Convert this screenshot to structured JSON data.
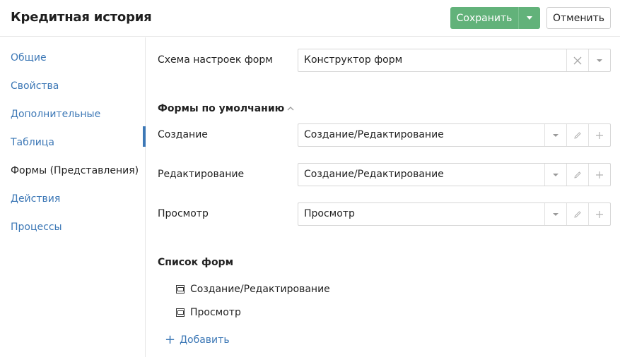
{
  "header": {
    "title": "Кредитная история",
    "save_label": "Сохранить",
    "cancel_label": "Отменить"
  },
  "sidebar": {
    "items": [
      {
        "label": "Общие",
        "active": false
      },
      {
        "label": "Свойства",
        "active": false
      },
      {
        "label": "Дополнительные",
        "active": false
      },
      {
        "label": "Таблица",
        "active": false
      },
      {
        "label": "Формы (Представления)",
        "active": true
      },
      {
        "label": "Действия",
        "active": false
      },
      {
        "label": "Процессы",
        "active": false
      }
    ]
  },
  "scheme": {
    "label": "Схема настроек форм",
    "value": "Конструктор форм"
  },
  "default_forms": {
    "title": "Формы по умолчанию",
    "rows": [
      {
        "label": "Создание",
        "value": "Создание/Редактирование"
      },
      {
        "label": "Редактирование",
        "value": "Создание/Редактирование"
      },
      {
        "label": "Просмотр",
        "value": "Просмотр"
      }
    ]
  },
  "forms_list": {
    "title": "Список форм",
    "items": [
      "Создание/Редактирование",
      "Просмотр"
    ],
    "add_label": "Добавить"
  },
  "colors": {
    "accent": "#3d78b6",
    "save_button": "#62b27a"
  }
}
